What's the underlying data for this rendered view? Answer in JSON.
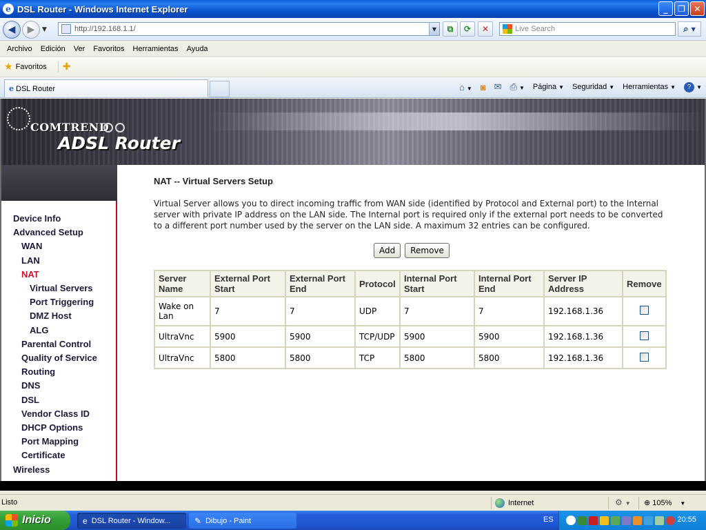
{
  "window": {
    "title": "DSL Router - Windows Internet Explorer"
  },
  "address_bar": {
    "url": "http://192.168.1.1/",
    "search_placeholder": "Live Search"
  },
  "menu": [
    "Archivo",
    "Edición",
    "Ver",
    "Favoritos",
    "Herramientas",
    "Ayuda"
  ],
  "favorites": {
    "label": "Favoritos"
  },
  "tab": {
    "title": "DSL Router"
  },
  "command_bar": {
    "page": "Página",
    "security": "Seguridad",
    "tools": "Herramientas"
  },
  "banner": {
    "brand": "COMTREND",
    "product": "ADSL Router"
  },
  "sidebar": {
    "items": [
      {
        "label": "Device Info",
        "level": 0
      },
      {
        "label": "Advanced Setup",
        "level": 0
      },
      {
        "label": "WAN",
        "level": 1
      },
      {
        "label": "LAN",
        "level": 1
      },
      {
        "label": "NAT",
        "level": 1,
        "active": true
      },
      {
        "label": "Virtual Servers",
        "level": 2
      },
      {
        "label": "Port Triggering",
        "level": 2
      },
      {
        "label": "DMZ Host",
        "level": 2
      },
      {
        "label": "ALG",
        "level": 2
      },
      {
        "label": "Parental Control",
        "level": 1
      },
      {
        "label": "Quality of Service",
        "level": 1
      },
      {
        "label": "Routing",
        "level": 1
      },
      {
        "label": "DNS",
        "level": 1
      },
      {
        "label": "DSL",
        "level": 1
      },
      {
        "label": "Vendor Class ID",
        "level": 1
      },
      {
        "label": "DHCP Options",
        "level": 1
      },
      {
        "label": "Port Mapping",
        "level": 1
      },
      {
        "label": "Certificate",
        "level": 1
      },
      {
        "label": "Wireless",
        "level": 0
      }
    ]
  },
  "main": {
    "heading": "NAT -- Virtual Servers Setup",
    "description": "Virtual Server allows you to direct incoming traffic from WAN side (identified by Protocol and External port) to the Internal server with private IP address on the LAN side. The Internal port is required only if the external port needs to be converted to a different port number used by the server on the LAN side. A maximum 32 entries can be configured.",
    "add_label": "Add",
    "remove_label": "Remove",
    "table": {
      "headers": [
        "Server Name",
        "External Port Start",
        "External Port End",
        "Protocol",
        "Internal Port Start",
        "Internal Port End",
        "Server IP Address",
        "Remove"
      ],
      "rows": [
        [
          "Wake on Lan",
          "7",
          "7",
          "UDP",
          "7",
          "7",
          "192.168.1.36"
        ],
        [
          "UltraVnc",
          "5900",
          "5900",
          "TCP/UDP",
          "5900",
          "5900",
          "192.168.1.36"
        ],
        [
          "UltraVnc",
          "5800",
          "5800",
          "TCP",
          "5800",
          "5800",
          "192.168.1.36"
        ]
      ]
    }
  },
  "status_bar": {
    "status": "Listo",
    "zone": "Internet",
    "zoom": "105%"
  },
  "taskbar": {
    "start": "Inicio",
    "items": [
      "DSL Router - Window...",
      "Dibujo - Paint"
    ],
    "language": "ES",
    "clock": "20:55"
  }
}
